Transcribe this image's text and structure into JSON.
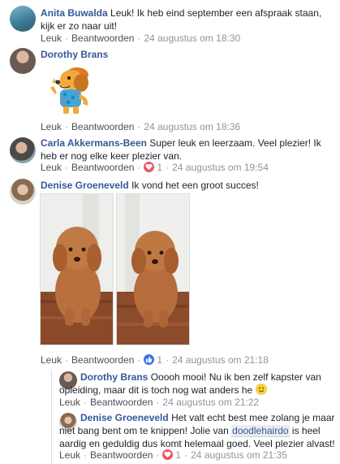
{
  "actions": {
    "like": "Leuk",
    "reply": "Beantwoorden"
  },
  "comments": [
    {
      "author": "Anita Buwalda",
      "text": "Leuk! Ik heb eind september een afspraak staan, kijk er zo naar uit!",
      "time": "24 augustus om 18:30"
    },
    {
      "author": "Dorothy Brans",
      "sticker": "dog-sticker",
      "time": "24 augustus om 18:36"
    },
    {
      "author": "Carla Akkermans-Been",
      "text": "Super leuk en leerzaam. Veel plezier! Ik heb er nog elke keer plezier van.",
      "reaction_count": "1",
      "reaction": "heart",
      "time": "24 augustus om 19:54"
    },
    {
      "author": "Denise Groeneveld",
      "text": "Ik vond het een groot succes!",
      "reaction_count": "1",
      "reaction": "like",
      "time": "24 augustus om 21:18"
    }
  ],
  "replies": [
    {
      "author": "Dorothy Brans",
      "text": "Ooooh mooi! Nu ik ben zelf kapster van opleiding, maar dit is toch nog wat anders he",
      "time": "24 augustus om 21:22"
    },
    {
      "author": "Denise Groeneveld",
      "text_before": "Het valt echt best mee zolang je maar niet bang bent om te knippen! Jolie van ",
      "tag": "doodlehairdo",
      "text_after": " is heel aardig en geduldig dus komt helemaal goed. Veel plezier alvast!",
      "reaction_count": "1",
      "reaction": "heart",
      "time": "24 augustus om 21:35"
    }
  ],
  "colors": {
    "name": "#365899",
    "link": "#4b4f56",
    "meta": "#90949c",
    "heart": "#f25268",
    "like": "#3b73e8"
  }
}
